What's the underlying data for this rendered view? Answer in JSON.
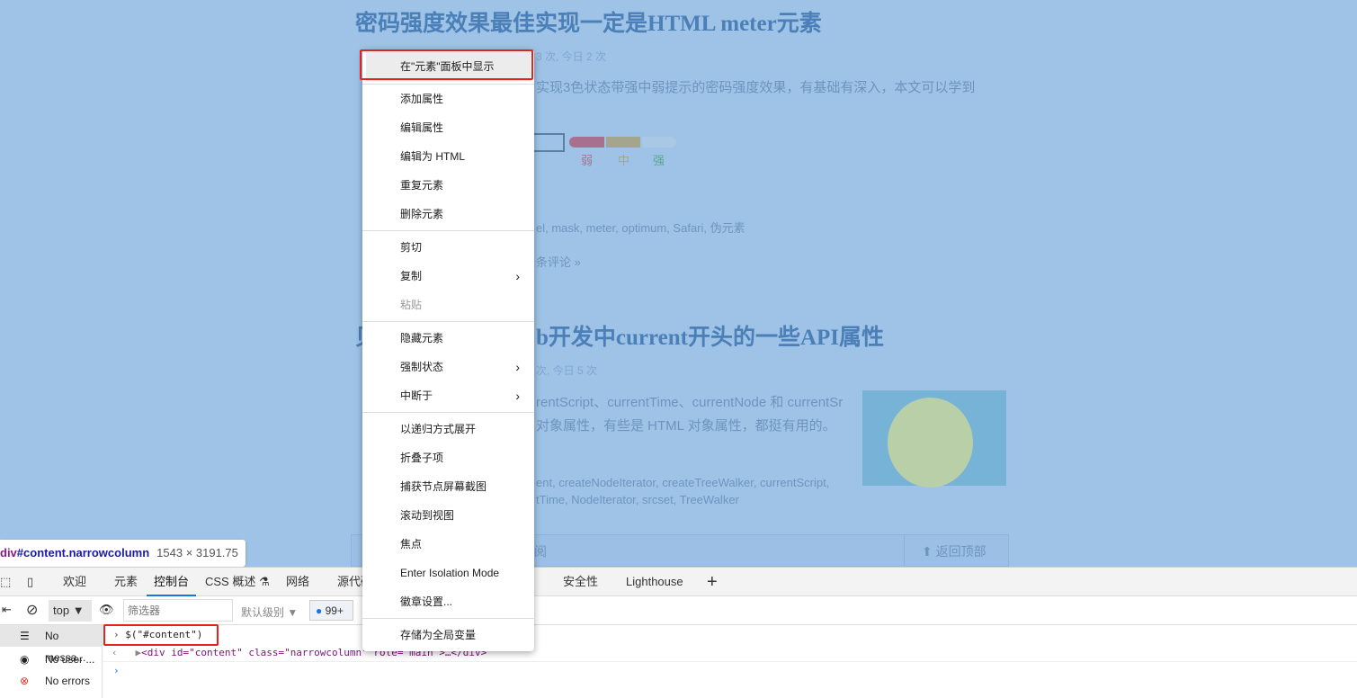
{
  "page": {
    "article1": {
      "title": "密码强度效果最佳实现一定是HTML meter元素",
      "meta_fragment": "3 次, 今日 2 次",
      "excerpt_fragment": "实现3色状态带强中弱提示的密码强度效果，有基础有深入，本文可以学到",
      "strength_labels": [
        "弱",
        "中",
        "强"
      ],
      "strength_colors": [
        "#a8708f",
        "#a3a68c",
        "#a8c8e5"
      ],
      "tags_fragment": "el, mask, meter, optimum, Safari, 伪元素",
      "comments_fragment": "条评论 »"
    },
    "article2": {
      "title_fragment": "b开发中current开头的一些API属性",
      "title_prefix": "贝",
      "meta_fragment": "次, 今日 5 次",
      "excerpt_line1": "rentScript、currentTime、currentNode 和 currentSr",
      "excerpt_line2": "对象属性，有些是 HTML 对象属性，都挺有用的。",
      "tags_line1": "ent, createNodeIterator, createTreeWalker, currentScript,",
      "tags_line2": "tTime, NodeIterator, srcset, TreeWalker"
    },
    "footer": {
      "read_fragment": "阅",
      "back_to_top": "返回顶部"
    }
  },
  "tooltip": {
    "tag": "div",
    "id": "#content",
    "class": ".narrowcolumn",
    "size": "1543 × 3191.75"
  },
  "devtools": {
    "tabs": [
      "欢迎",
      "元素",
      "控制台",
      "CSS 概述",
      "网络",
      "源代码",
      "安全性",
      "Lighthouse"
    ],
    "active_tab": "控制台",
    "toolbar": {
      "context": "top",
      "filter_placeholder": "筛选器",
      "level": "默认级别",
      "issues_count": "99+"
    },
    "sidebar": [
      {
        "label": "No messa...",
        "icon": "list-icon"
      },
      {
        "label": "No user ...",
        "icon": "user-icon"
      },
      {
        "label": "No errors",
        "icon": "error-icon"
      }
    ],
    "console": {
      "input": "$(\"#content\")",
      "output": "<div id=\"content\" class=\"narrowcolumn\" role=\"main\">…</div>"
    }
  },
  "context_menu": {
    "items": [
      "在\"元素\"面板中显示",
      "添加属性",
      "编辑属性",
      "编辑为 HTML",
      "重复元素",
      "删除元素",
      "剪切",
      "复制",
      "粘贴",
      "隐藏元素",
      "强制状态",
      "中断于",
      "以递归方式展开",
      "折叠子项",
      "捕获节点屏幕截图",
      "滚动到视图",
      "焦点",
      "Enter Isolation Mode",
      "徽章设置...",
      "存储为全局变量"
    ],
    "highlighted": "在\"元素\"面板中显示",
    "disabled": [
      "粘贴"
    ],
    "submenus": [
      "复制",
      "强制状态",
      "中断于"
    ]
  },
  "colors": {
    "highlight_overlay": "#9fc3e7",
    "accent": "#1a73e8",
    "annotation_red": "#e8221b"
  }
}
